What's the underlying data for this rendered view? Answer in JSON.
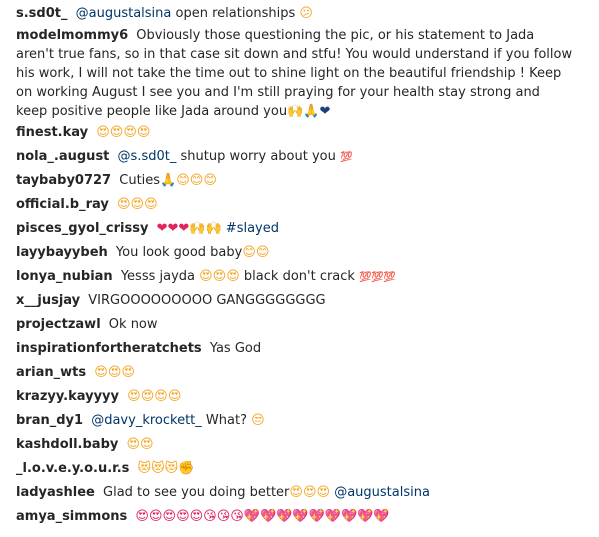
{
  "comments": [
    {
      "user": "s.sd0t_",
      "mention": "@augustalsina",
      "text": " open relationships",
      "emoji": "😕"
    },
    {
      "user": "modelmommy6",
      "text": "Obviously those questioning the pic, or his statement to Jada aren't true fans, so in that case sit down and stfu! You would understand if you follow his work, I will not take the time out to shine light on the beautiful friendship ! Keep on working August I see you and I'm still praying for your health stay strong and keep positive people like Jada around you",
      "emoji": "🙌🙏❤"
    },
    {
      "user": "finest.kay",
      "emoji": "😍😍😍😍"
    },
    {
      "user": "nola_.august",
      "mention": "@s.sd0t_",
      "text": " shutup worry about you ",
      "emoji": "💯"
    },
    {
      "user": "taybaby0727",
      "text": "Cuties",
      "emoji": "🙏😊😊😊"
    },
    {
      "user": "official.b_ray",
      "emoji": "😍😍😍"
    },
    {
      "user": "pisces_gyol_crissy",
      "emoji": "❤❤❤🙌🙌",
      "tag": "#slayed"
    },
    {
      "user": "layybayybeh",
      "text": "You look good baby",
      "emoji": "😊😊"
    },
    {
      "user": "lonya_nubian",
      "text": "Yesss jayda ",
      "emoji": "😍😍😍",
      "text2": " black don't crack ",
      "emoji2": "💯💯💯"
    },
    {
      "user": "x__jusjay",
      "text": "VIRGOOOOOOOOO GANGGGGGGGG"
    },
    {
      "user": "projectzawl",
      "text": "Ok now"
    },
    {
      "user": "inspirationfortheratchets",
      "text": "Yas God"
    },
    {
      "user": "arian_wts",
      "emoji": "😍😍😍"
    },
    {
      "user": "krazyy.kayyyy",
      "emoji": "😍😍😍😍"
    },
    {
      "user": "bran_dy1",
      "mention": "@davy_krockett_",
      "text": " What? ",
      "emoji": "😒"
    },
    {
      "user": "kashdoll.baby",
      "emoji": "😍😍"
    },
    {
      "user": "_l.o.v.e.y.o.u.r.s",
      "emoji": "😻😻😻✊"
    },
    {
      "user": "ladyashlee",
      "text": "Glad to see you doing better",
      "emoji": "😍😍😍",
      "mention": "@augustalsina"
    },
    {
      "user": "amya_simmons",
      "emoji": "😍😍😍😍😍😘😘😘💖💖💖💖💖💖💖💖💖"
    }
  ]
}
